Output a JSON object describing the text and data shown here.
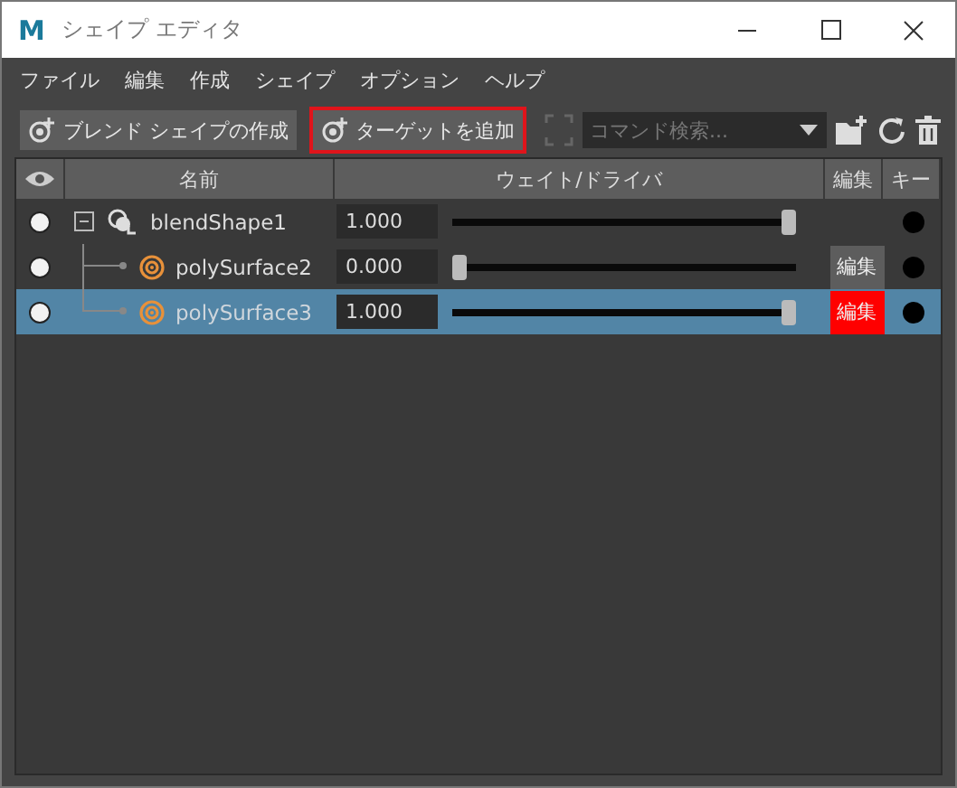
{
  "window": {
    "logo": "M",
    "title": "シェイプ エディタ"
  },
  "menu": [
    "ファイル",
    "編集",
    "作成",
    "シェイプ",
    "オプション",
    "ヘルプ"
  ],
  "toolbar": {
    "buttons": [
      {
        "label": "ブレンド シェイプの作成",
        "highlighted": false
      },
      {
        "label": "ターゲットを追加",
        "highlighted": true
      }
    ],
    "search": {
      "placeholder": "コマンド検索..."
    }
  },
  "table": {
    "columns": [
      "名前",
      "ウェイト/ドライバ",
      "編集",
      "キー"
    ],
    "rows": [
      {
        "name": "blendShape1",
        "kind": "group",
        "value": "1.000",
        "level": 1,
        "selected": false,
        "expanded": true,
        "children": [
          {
            "name": "polySurface2",
            "kind": "target",
            "value": "0.000",
            "level": 0,
            "selected": false,
            "edit": {
              "label": "編集",
              "active": false
            }
          },
          {
            "name": "polySurface3",
            "kind": "target",
            "value": "1.000",
            "level": 1,
            "selected": true,
            "edit": {
              "label": "編集",
              "active": true
            }
          }
        ]
      }
    ]
  }
}
